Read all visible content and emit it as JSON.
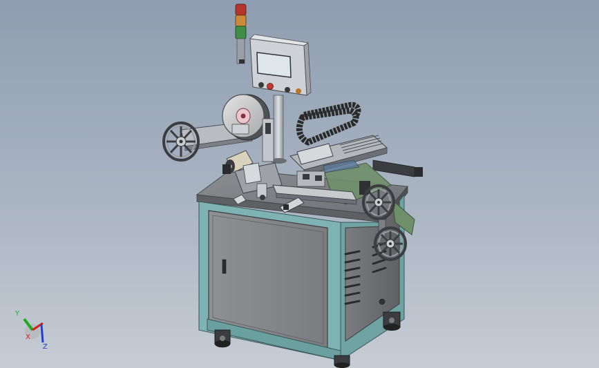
{
  "viewport": {
    "background_top": "#8e9db0",
    "background_bottom": "#c6ccd4"
  },
  "colors": {
    "cabinet_frame": "#7fb3b3",
    "cabinet_panel": "#8a8a8a",
    "metal_light": "#c9ccd0",
    "metal_dark": "#6c7076",
    "cable_chain": "#2b2b2b",
    "green_film": "#6f8f6a",
    "tower_red": "#b5352c",
    "tower_orange": "#c98a3a",
    "tower_green": "#3f8d46"
  },
  "triad": {
    "x_label": "X",
    "y_label": "Y",
    "z_label": "Z",
    "x_color": "#d11f1f",
    "y_color": "#1faa1f",
    "z_color": "#1f3fd1"
  }
}
